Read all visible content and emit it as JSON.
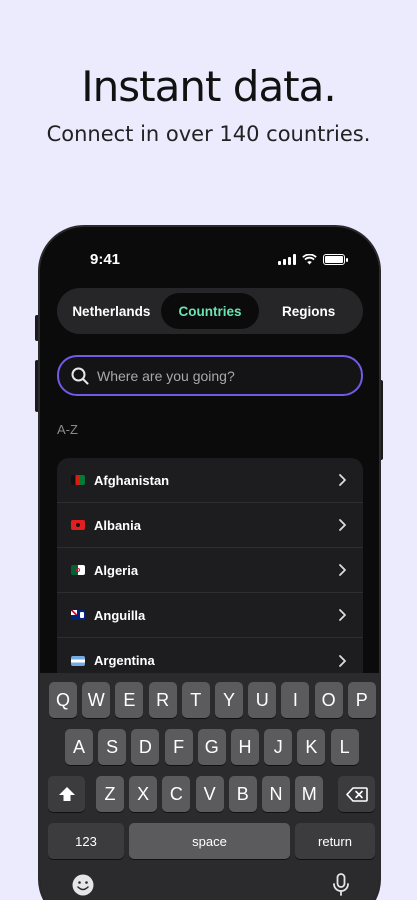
{
  "hero": {
    "title": "Instant data.",
    "subtitle": "Connect in over 140 countries."
  },
  "status_bar": {
    "time": "9:41",
    "battery_level": 1.0
  },
  "tabs": [
    {
      "label": "Netherlands",
      "active": false
    },
    {
      "label": "Countries",
      "active": true
    },
    {
      "label": "Regions",
      "active": false
    }
  ],
  "search": {
    "placeholder": "Where are you going?",
    "value": ""
  },
  "section_label": "A-Z",
  "countries": [
    {
      "name": "Afghanistan",
      "icon": "afghanistan-flag-icon"
    },
    {
      "name": "Albania",
      "icon": "albania-flag-icon"
    },
    {
      "name": "Algeria",
      "icon": "algeria-flag-icon"
    },
    {
      "name": "Anguilla",
      "icon": "anguilla-flag-icon"
    },
    {
      "name": "Argentina",
      "icon": "argentina-flag-icon"
    }
  ],
  "keyboard": {
    "row1": [
      "Q",
      "W",
      "E",
      "R",
      "T",
      "Y",
      "U",
      "I",
      "O",
      "P"
    ],
    "row2": [
      "A",
      "S",
      "D",
      "F",
      "G",
      "H",
      "J",
      "K",
      "L"
    ],
    "row3": [
      "Z",
      "X",
      "C",
      "V",
      "B",
      "N",
      "M"
    ],
    "numbers_key": "123",
    "space_key": "space",
    "return_key": "return"
  },
  "colors": {
    "background": "#ECEAFD",
    "accent": "#6BE3B3",
    "search_border": "#6F5CE6"
  }
}
